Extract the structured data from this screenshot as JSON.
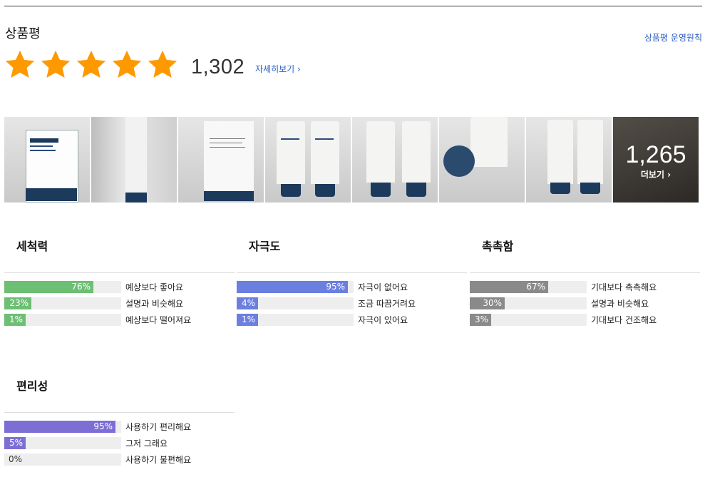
{
  "header": {
    "title": "상품평",
    "policy_link": "상품평 운영원칙"
  },
  "rating": {
    "stars": 5,
    "review_count": "1,302",
    "detail_link": "자세히보기"
  },
  "photos": {
    "items": [
      "photo-1",
      "photo-2",
      "photo-3",
      "photo-4",
      "photo-5",
      "photo-6",
      "photo-7"
    ],
    "more_count": "1,265",
    "more_label": "더보기"
  },
  "colors": {
    "green": "#6dbf74",
    "blue": "#6b7fe0",
    "gray": "#8a8a8a",
    "purple": "#7d6ed6",
    "star": "#ff9900",
    "link": "#2b5cc4"
  },
  "surveys": [
    {
      "title": "세척력",
      "color": "green",
      "rows": [
        {
          "pct": "76%",
          "value": 0.76,
          "label": "예상보다 좋아요"
        },
        {
          "pct": "23%",
          "value": 0.23,
          "label": "설명과 비슷해요"
        },
        {
          "pct": "1%",
          "value": 0.01,
          "label": "예상보다 떨어져요"
        }
      ]
    },
    {
      "title": "자극도",
      "color": "blue",
      "rows": [
        {
          "pct": "95%",
          "value": 0.95,
          "label": "자극이 없어요"
        },
        {
          "pct": "4%",
          "value": 0.04,
          "label": "조금 따끔거려요"
        },
        {
          "pct": "1%",
          "value": 0.01,
          "label": "자극이 있어요"
        }
      ]
    },
    {
      "title": "촉촉함",
      "color": "gray",
      "rows": [
        {
          "pct": "67%",
          "value": 0.67,
          "label": "기대보다 촉촉해요"
        },
        {
          "pct": "30%",
          "value": 0.3,
          "label": "설명과 비슷해요"
        },
        {
          "pct": "3%",
          "value": 0.03,
          "label": "기대보다 건조해요"
        }
      ]
    },
    {
      "title": "편리성",
      "color": "purple",
      "rows": [
        {
          "pct": "95%",
          "value": 0.95,
          "label": "사용하기 편리해요"
        },
        {
          "pct": "5%",
          "value": 0.05,
          "label": "그저 그래요"
        },
        {
          "pct": "0%",
          "value": 0.0,
          "label": "사용하기 불편해요"
        }
      ]
    }
  ]
}
